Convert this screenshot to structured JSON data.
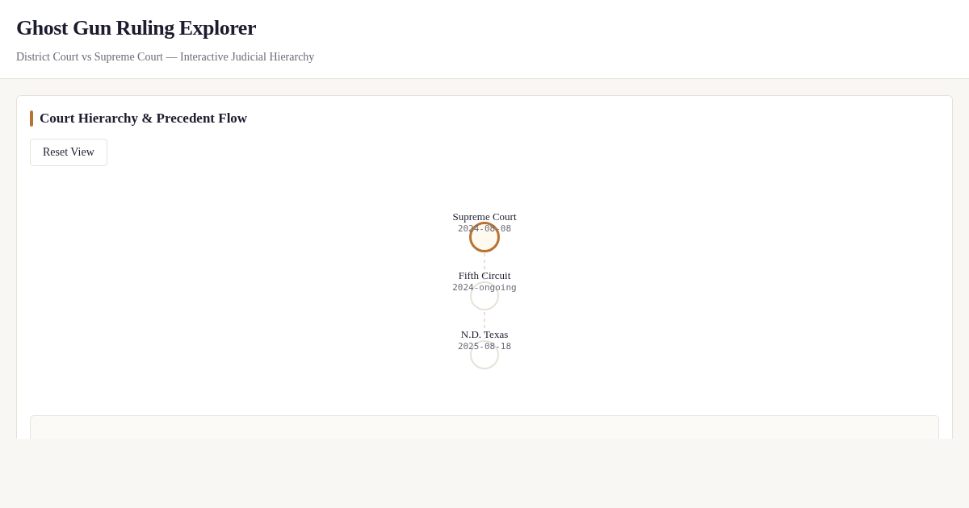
{
  "header": {
    "title": "Ghost Gun Ruling Explorer",
    "subtitle": "District Court vs Supreme Court — Interactive Judicial Hierarchy"
  },
  "panel": {
    "title": "Court Hierarchy & Precedent Flow",
    "reset_button": "Reset View",
    "nodes": [
      {
        "name": "Supreme Court",
        "date": "2024-08-08",
        "selected": true
      },
      {
        "name": "Fifth Circuit",
        "date": "2024-ongoing",
        "selected": false
      },
      {
        "name": "N.D. Texas",
        "date": "2025-08-18",
        "selected": false
      }
    ]
  }
}
